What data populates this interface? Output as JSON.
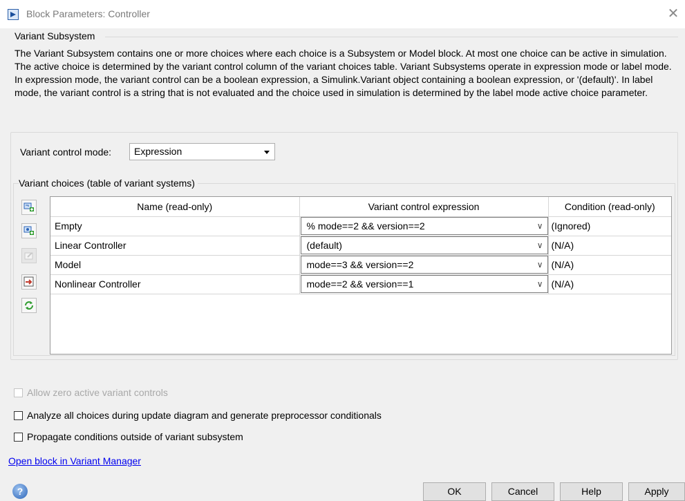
{
  "window": {
    "title": "Block Parameters: Controller",
    "close_glyph": "✕"
  },
  "group_title": "Variant Subsystem",
  "description": "The Variant Subsystem contains one or more choices where each choice is a Subsystem or Model block. At most one choice can be active in simulation. The active choice is determined by the variant control column of the variant choices table. Variant Subsystems operate in expression mode or label mode. In expression mode, the variant control can be a boolean expression, a Simulink.Variant object containing a boolean expression, or '(default)'. In label mode, the variant control is a string that is not evaluated and the choice used in simulation is determined by the label mode active choice parameter.",
  "mode": {
    "label": "Variant control mode:",
    "value": "Expression"
  },
  "choices": {
    "label": "Variant choices (table of variant systems)",
    "toolbar_icons": [
      "add-subsystem-choice-icon",
      "add-model-choice-icon",
      "edit-choice-icon",
      "open-block-icon",
      "refresh-icon"
    ],
    "columns": [
      "Name (read-only)",
      "Variant control expression",
      "Condition (read-only)"
    ],
    "rows": [
      {
        "name": "Empty",
        "expr": "% mode==2 && version==2",
        "cond": "(Ignored)"
      },
      {
        "name": "Linear Controller",
        "expr": "(default)",
        "cond": "(N/A)"
      },
      {
        "name": "Model",
        "expr": "mode==3 && version==2",
        "cond": "(N/A)"
      },
      {
        "name": "Nonlinear Controller",
        "expr": "mode==2 && version==1",
        "cond": "(N/A)"
      }
    ],
    "dropdown_glyph": "∨"
  },
  "options": {
    "allow_zero": "Allow zero active variant controls",
    "analyze_all": "Analyze all choices during update diagram and generate preprocessor conditionals",
    "propagate": "Propagate conditions outside of variant subsystem"
  },
  "link": "Open block in Variant Manager",
  "buttons": {
    "ok": "OK",
    "cancel": "Cancel",
    "help": "Help",
    "apply": "Apply",
    "help_glyph": "?"
  },
  "colors": {
    "link": "#0000ee",
    "icon_green": "#2e9c2e",
    "icon_blue": "#2a63b8"
  }
}
